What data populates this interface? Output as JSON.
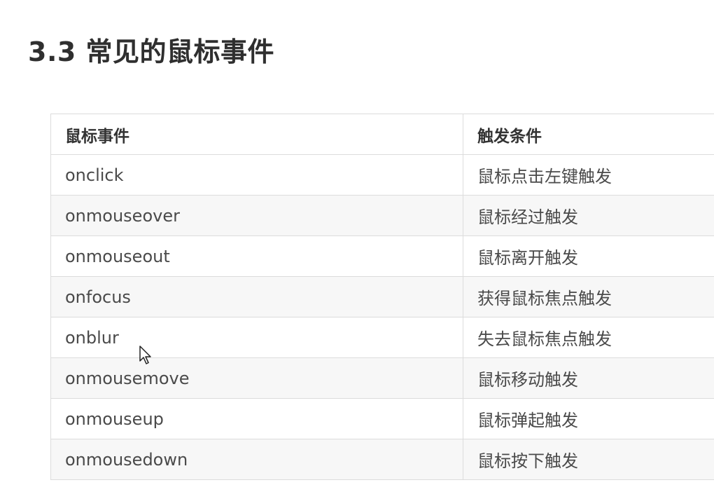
{
  "title": "3.3 常见的鼠标事件",
  "table": {
    "headers": [
      "鼠标事件",
      "触发条件"
    ],
    "rows": [
      {
        "event": "onclick",
        "condition": "鼠标点击左键触发"
      },
      {
        "event": "onmouseover",
        "condition": "鼠标经过触发"
      },
      {
        "event": "onmouseout",
        "condition": "鼠标离开触发"
      },
      {
        "event": "onfocus",
        "condition": "获得鼠标焦点触发"
      },
      {
        "event": "onblur",
        "condition": "失去鼠标焦点触发"
      },
      {
        "event": "onmousemove",
        "condition": "鼠标移动触发"
      },
      {
        "event": "onmouseup",
        "condition": "鼠标弹起触发"
      },
      {
        "event": "onmousedown",
        "condition": "鼠标按下触发"
      }
    ]
  },
  "cursor_icon": "arrow-pointer-icon"
}
